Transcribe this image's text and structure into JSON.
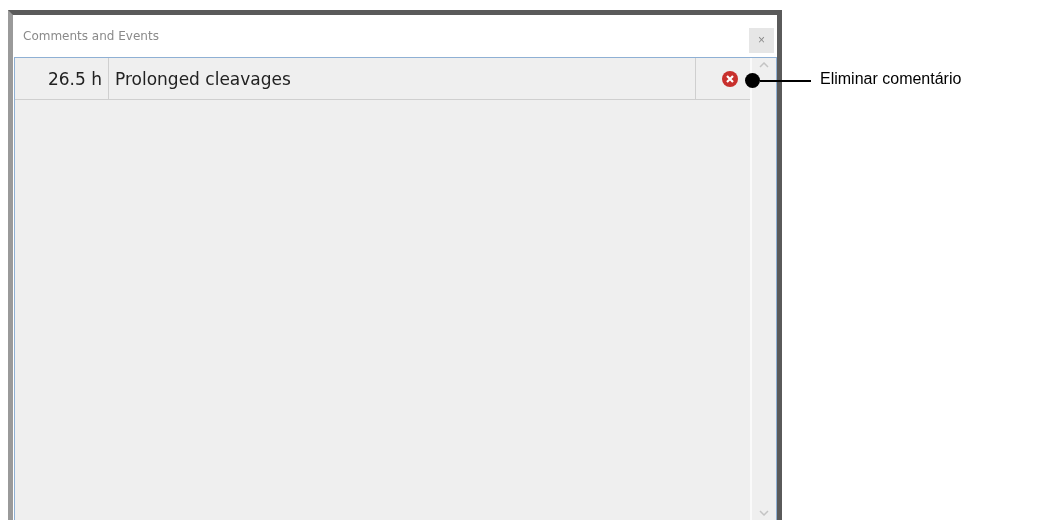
{
  "window": {
    "title": "Comments and Events",
    "close": "×"
  },
  "comments": [
    {
      "time": "26.5 h",
      "text": "Prolonged cleavages"
    }
  ],
  "callout": {
    "label": "Eliminar comentário"
  }
}
